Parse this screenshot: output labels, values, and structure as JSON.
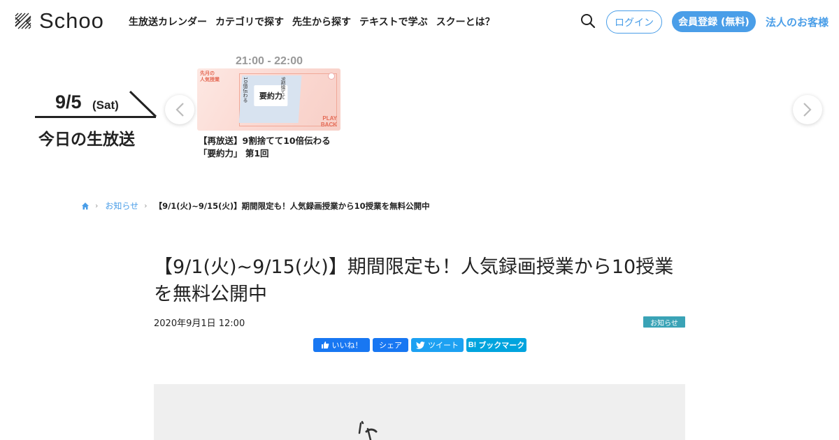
{
  "header": {
    "logo_text": "Schoo",
    "nav": [
      {
        "label": "生放送カレンダー"
      },
      {
        "label": "カテゴリで探す"
      },
      {
        "label": "先生から探す"
      },
      {
        "label": "テキストで学ぶ"
      },
      {
        "label": "スクーとは？"
      }
    ],
    "login_label": "ログイン",
    "register_label": "会員登録 (無料)",
    "corporate_label": "法人のお客様",
    "brand_color": "#4a9ee8"
  },
  "live": {
    "date": "9/5",
    "day": "(Sat)",
    "heading": "今日の生放送",
    "slot": {
      "time": "21:00 - 22:00",
      "thumb_tag": "先月の\n人気授業",
      "thumb_left": "10倍伝わる",
      "thumb_center": "要約力",
      "thumb_right": "9割捨てて",
      "thumb_badge": "PLAY\nBACK",
      "title": "【再放送】9割捨てて10倍伝わる「要約力」 第1回"
    }
  },
  "breadcrumb": {
    "category": "お知らせ",
    "current": "【9/1(火)~9/15(火)】期間限定も！人気録画授業から10授業を無料公開中"
  },
  "article": {
    "title": "【9/1(火)~9/15(火)】期間限定も！人気録画授業から10授業を無料公開中",
    "date": "2020年9月1日 12:00",
    "category": "お知らせ",
    "category_color": "#3aa3b6"
  },
  "share": {
    "fb_like": "いいね！",
    "fb_share": "シェア",
    "tweet": "ツイート",
    "hatena": "ブックマーク"
  }
}
